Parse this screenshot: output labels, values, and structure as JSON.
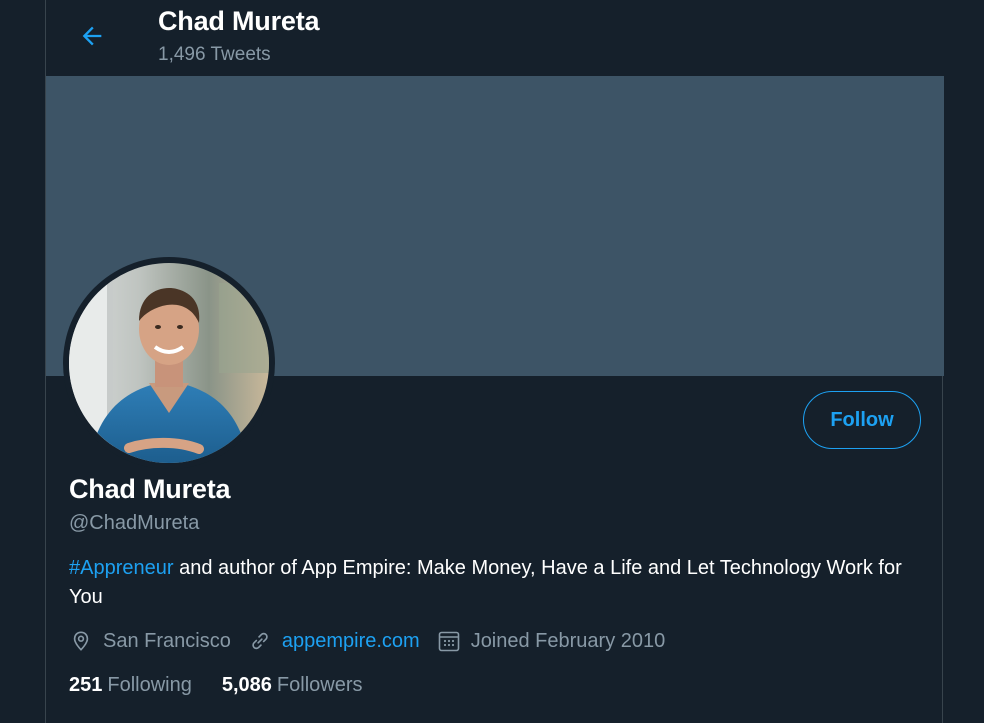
{
  "colors": {
    "background": "#15202b",
    "banner": "#3d5466",
    "accent": "#1da1f2",
    "muted": "#8899a6",
    "border": "#38444d"
  },
  "header": {
    "back_icon": "arrow-left-icon",
    "name": "Chad Mureta",
    "tweet_count": "1,496 Tweets"
  },
  "profile": {
    "follow_label": "Follow",
    "name": "Chad Mureta",
    "handle": "@ChadMureta",
    "bio": {
      "hashtag": "#Appreneur",
      "text": " and author of App Empire: Make Money, Have a Life and Let Technology Work for You"
    },
    "meta": {
      "location_icon": "location-pin-icon",
      "location": "San Francisco",
      "link_icon": "link-icon",
      "website": "appempire.com",
      "calendar_icon": "calendar-icon",
      "joined": "Joined February 2010"
    },
    "stats": {
      "following_count": "251",
      "following_label": "Following",
      "followers_count": "5,086",
      "followers_label": "Followers"
    }
  }
}
